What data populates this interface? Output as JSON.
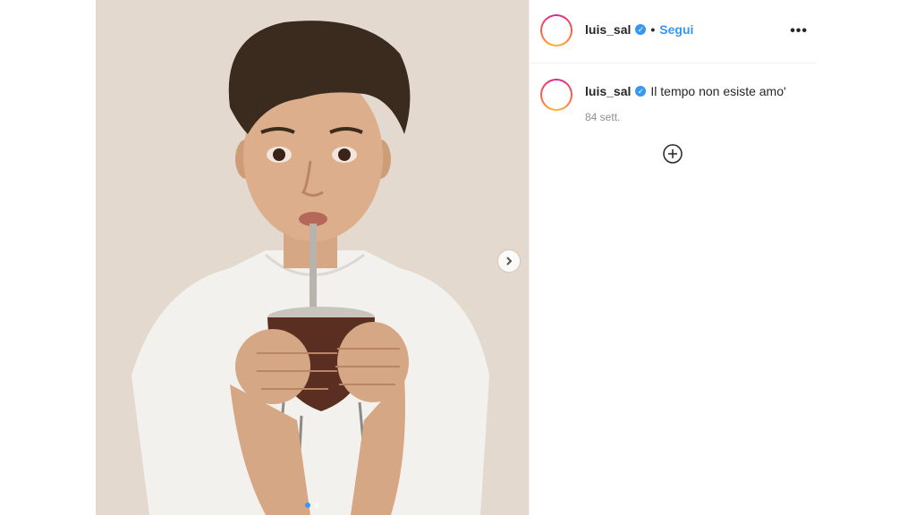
{
  "post": {
    "image_alt": "Boy drinking mate from a gourd with a metal straw",
    "carousel": {
      "total_slides": 2,
      "active_slide": 1
    }
  },
  "header": {
    "username": "luis_sal",
    "separator": "•",
    "follow_label": "Segui",
    "more_label": "•••"
  },
  "caption": {
    "username": "luis_sal",
    "text": "Il tempo non esiste amo'",
    "time": "84 sett."
  },
  "colors": {
    "accent": "#3897f0",
    "verified": "#3897f0",
    "muted": "#8e8e8e",
    "border": "#efefef"
  },
  "icons": {
    "verified": "verified-badge-icon",
    "next": "chevron-right-icon",
    "add": "circle-plus-icon",
    "more": "more-horizontal-icon"
  }
}
